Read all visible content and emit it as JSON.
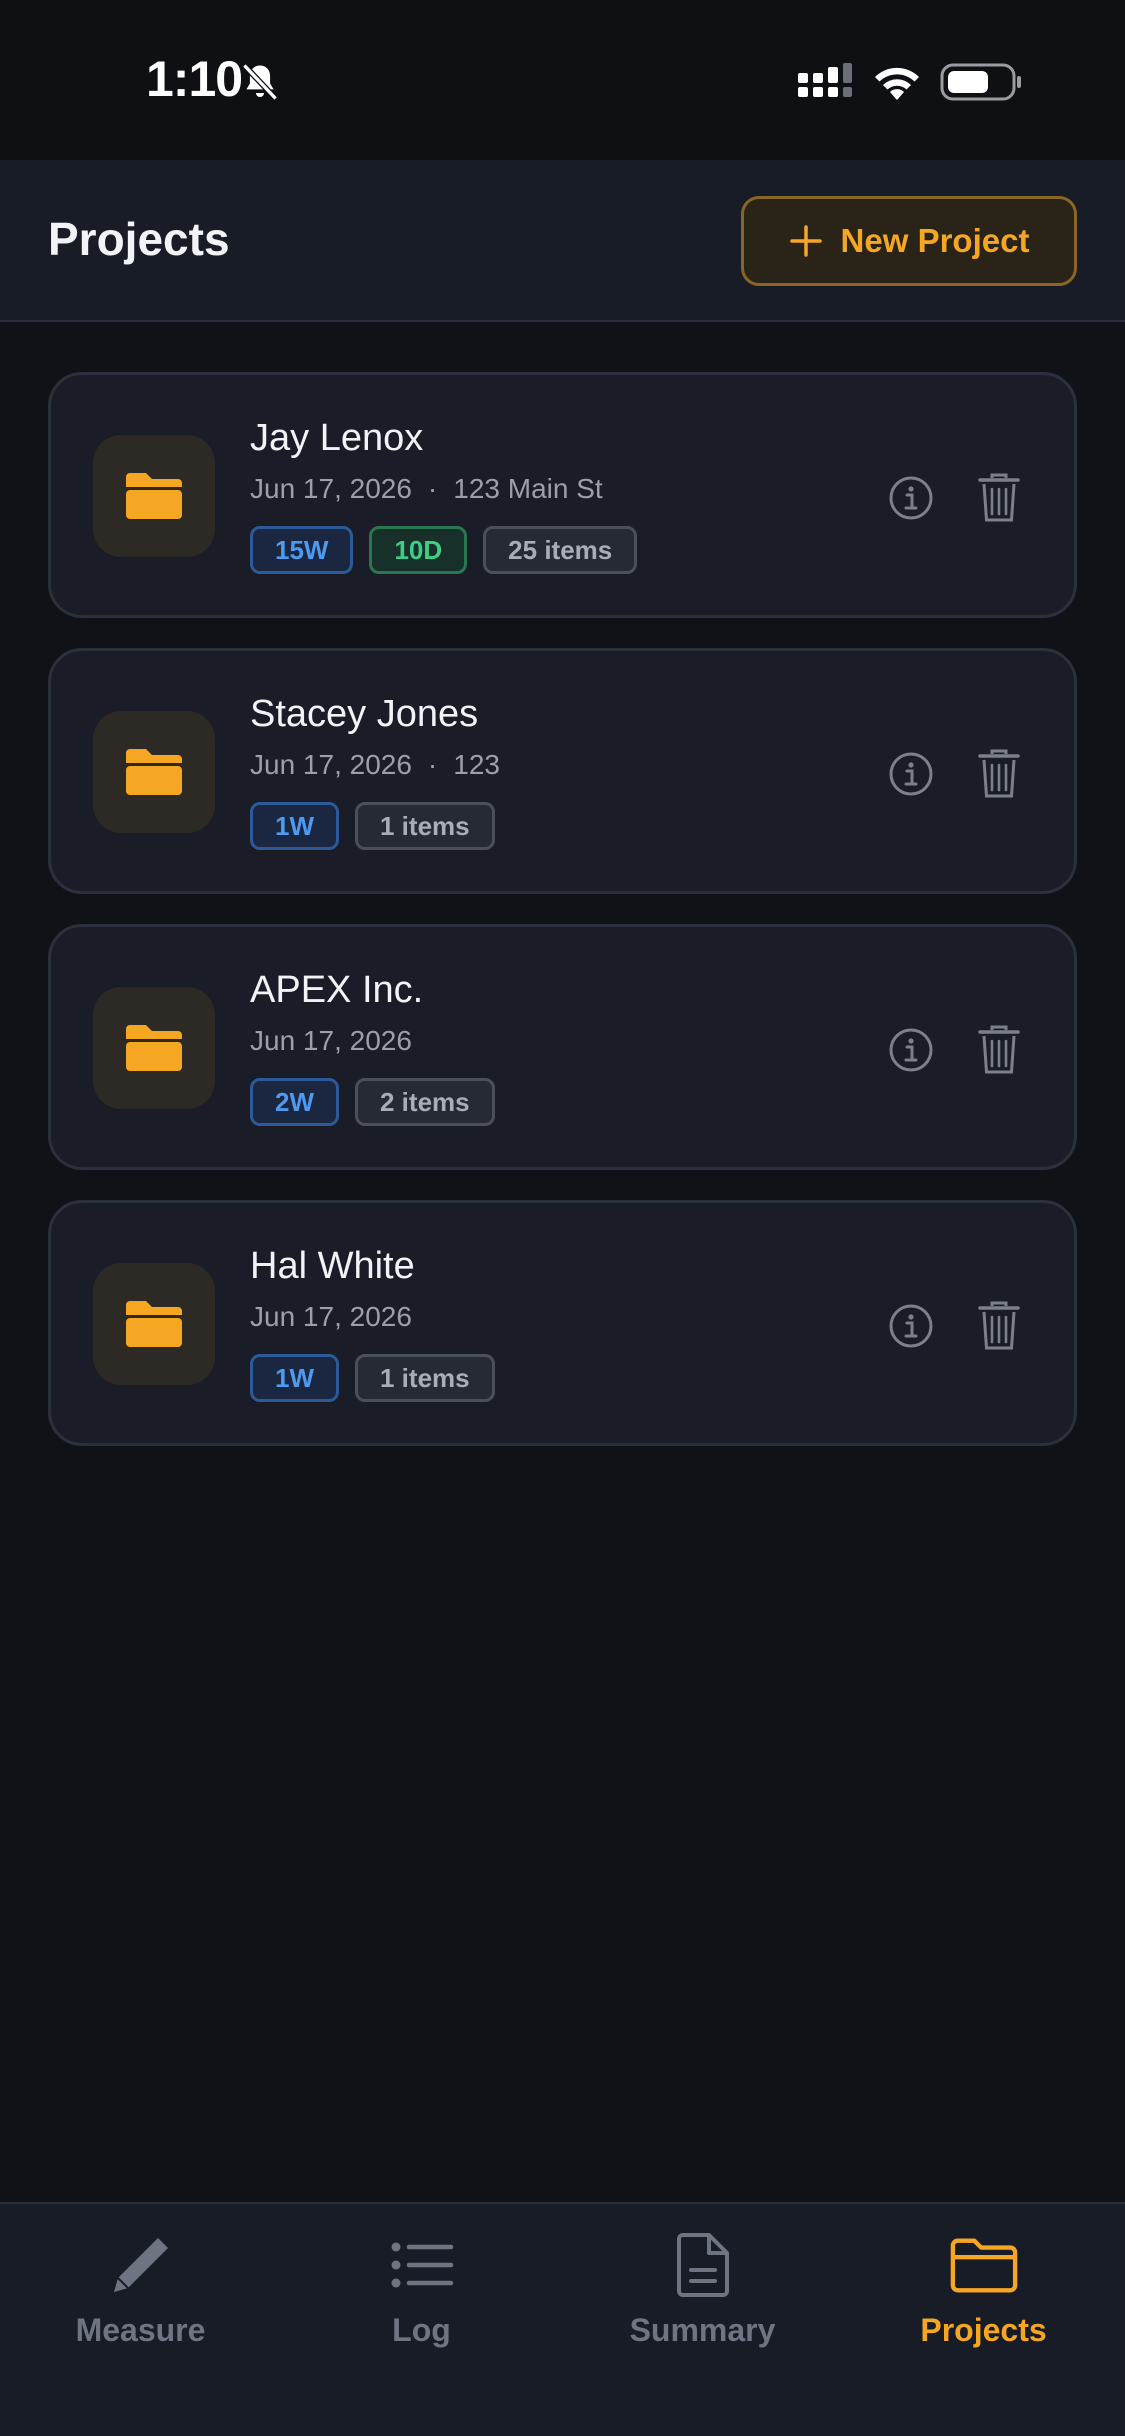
{
  "status_bar": {
    "time": "1:10"
  },
  "header": {
    "title": "Projects",
    "new_project_label": "New Project"
  },
  "projects": [
    {
      "name": "Jay Lenox",
      "date": "Jun 17, 2026",
      "separator": "·",
      "address": "123 Main St",
      "badges": [
        {
          "text": "15W",
          "color": "blue"
        },
        {
          "text": "10D",
          "color": "green"
        },
        {
          "text": "25 items",
          "color": "gray"
        }
      ]
    },
    {
      "name": "Stacey Jones",
      "date": "Jun 17, 2026",
      "separator": "·",
      "address": "123",
      "badges": [
        {
          "text": "1W",
          "color": "blue"
        },
        {
          "text": "1 items",
          "color": "gray"
        }
      ]
    },
    {
      "name": "APEX Inc.",
      "date": "Jun 17, 2026",
      "badges": [
        {
          "text": "2W",
          "color": "blue"
        },
        {
          "text": "2 items",
          "color": "gray"
        }
      ]
    },
    {
      "name": "Hal White",
      "date": "Jun 17, 2026",
      "badges": [
        {
          "text": "1W",
          "color": "blue"
        },
        {
          "text": "1 items",
          "color": "gray"
        }
      ]
    }
  ],
  "tabs": [
    {
      "label": "Measure",
      "icon": "pencil-icon",
      "active": false
    },
    {
      "label": "Log",
      "icon": "list-icon",
      "active": false
    },
    {
      "label": "Summary",
      "icon": "document-icon",
      "active": false
    },
    {
      "label": "Projects",
      "icon": "folder-icon",
      "active": true
    }
  ],
  "colors": {
    "accent": "#f5a623",
    "background": "#111217",
    "card": "#1a1d27",
    "blue_badge": "#4c9bf0",
    "green_badge": "#3ecf86"
  }
}
